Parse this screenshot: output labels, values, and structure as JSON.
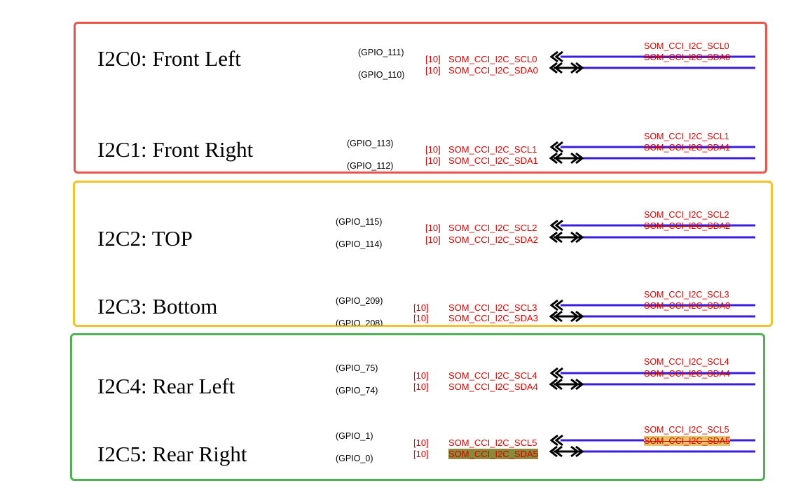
{
  "colors": {
    "box_front": "#e8534a",
    "box_topbottom": "#f6c22c",
    "box_rear": "#4db350",
    "wire": "#3a1ee0",
    "arrow": "#000000",
    "text_red": "#e00000"
  },
  "channels": [
    {
      "title": "I2C0: Front Left",
      "gpio_scl": "(GPIO_111)",
      "gpio_sda": "(GPIO_110)",
      "ref_scl": "[10]",
      "ref_sda": "[10]",
      "sig_scl": "SOM_CCI_I2C_SCL0",
      "sig_sda": "SOM_CCI_I2C_SDA0",
      "net_scl": "SOM_CCI_I2C_SCL0",
      "net_sda": "SOM_CCI_I2C_SDA0"
    },
    {
      "title": "I2C1: Front Right",
      "gpio_scl": "(GPIO_113)",
      "gpio_sda": "(GPIO_112)",
      "ref_scl": "[10]",
      "ref_sda": "[10]",
      "sig_scl": "SOM_CCI_I2C_SCL1",
      "sig_sda": "SOM_CCI_I2C_SDA1",
      "net_scl": "SOM_CCI_I2C_SCL1",
      "net_sda": "SOM_CCI_I2C_SDA1"
    },
    {
      "title": "I2C2: TOP",
      "gpio_scl": "(GPIO_115)",
      "gpio_sda": "(GPIO_114)",
      "ref_scl": "[10]",
      "ref_sda": "[10]",
      "sig_scl": "SOM_CCI_I2C_SCL2",
      "sig_sda": "SOM_CCI_I2C_SDA2",
      "net_scl": "SOM_CCI_I2C_SCL2",
      "net_sda": "SOM_CCI_I2C_SDA2"
    },
    {
      "title": "I2C3: Bottom",
      "gpio_scl": "(GPIO_209)",
      "gpio_sda": "(GPIO_208)",
      "ref_scl": "[10]",
      "ref_sda": "[10]",
      "sig_scl": "SOM_CCI_I2C_SCL3",
      "sig_sda": "SOM_CCI_I2C_SDA3",
      "net_scl": "SOM_CCI_I2C_SCL3",
      "net_sda": "SOM_CCI_I2C_SDA3"
    },
    {
      "title": "I2C4: Rear Left",
      "gpio_scl": "(GPIO_75)",
      "gpio_sda": "(GPIO_74)",
      "ref_scl": "[10]",
      "ref_sda": "[10]",
      "sig_scl": "SOM_CCI_I2C_SCL4",
      "sig_sda": "SOM_CCI_I2C_SDA4",
      "net_scl": "SOM_CCI_I2C_SCL4",
      "net_sda": "SOM_CCI_I2C_SDA4"
    },
    {
      "title": "I2C5: Rear Right",
      "gpio_scl": "(GPIO_1)",
      "gpio_sda": "(GPIO_0)",
      "ref_scl": "[10]",
      "ref_sda": "[10]",
      "sig_scl": "SOM_CCI_I2C_SCL5",
      "sig_sda": "SOM_CCI_I2C_SDA5",
      "net_scl": "SOM_CCI_I2C_SCL5",
      "net_sda": "SOM_CCI_I2C_SDA5"
    }
  ]
}
